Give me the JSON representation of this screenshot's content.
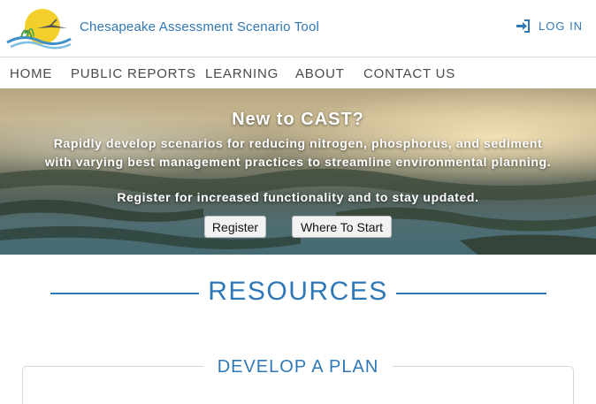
{
  "header": {
    "site_title": "Chesapeake Assessment Scenario Tool",
    "login_label": "LOG IN",
    "login_icon": "sign-in-icon",
    "accent_color": "#2f78b7"
  },
  "nav": {
    "items": [
      {
        "label": "HOME"
      },
      {
        "label": "PUBLIC REPORTS"
      },
      {
        "label": "LEARNING"
      },
      {
        "label": "ABOUT"
      },
      {
        "label": "CONTACT US"
      }
    ]
  },
  "hero": {
    "title": "New to CAST?",
    "text": "Rapidly develop scenarios for reducing nitrogen, phosphorus, and sediment with varying best management practices to streamline environmental planning.",
    "text2": "Register for increased functionality and to stay updated.",
    "register_label": "Register",
    "start_label": "Where To Start"
  },
  "resources": {
    "title": "RESOURCES"
  },
  "card": {
    "title": "DEVELOP A PLAN"
  }
}
